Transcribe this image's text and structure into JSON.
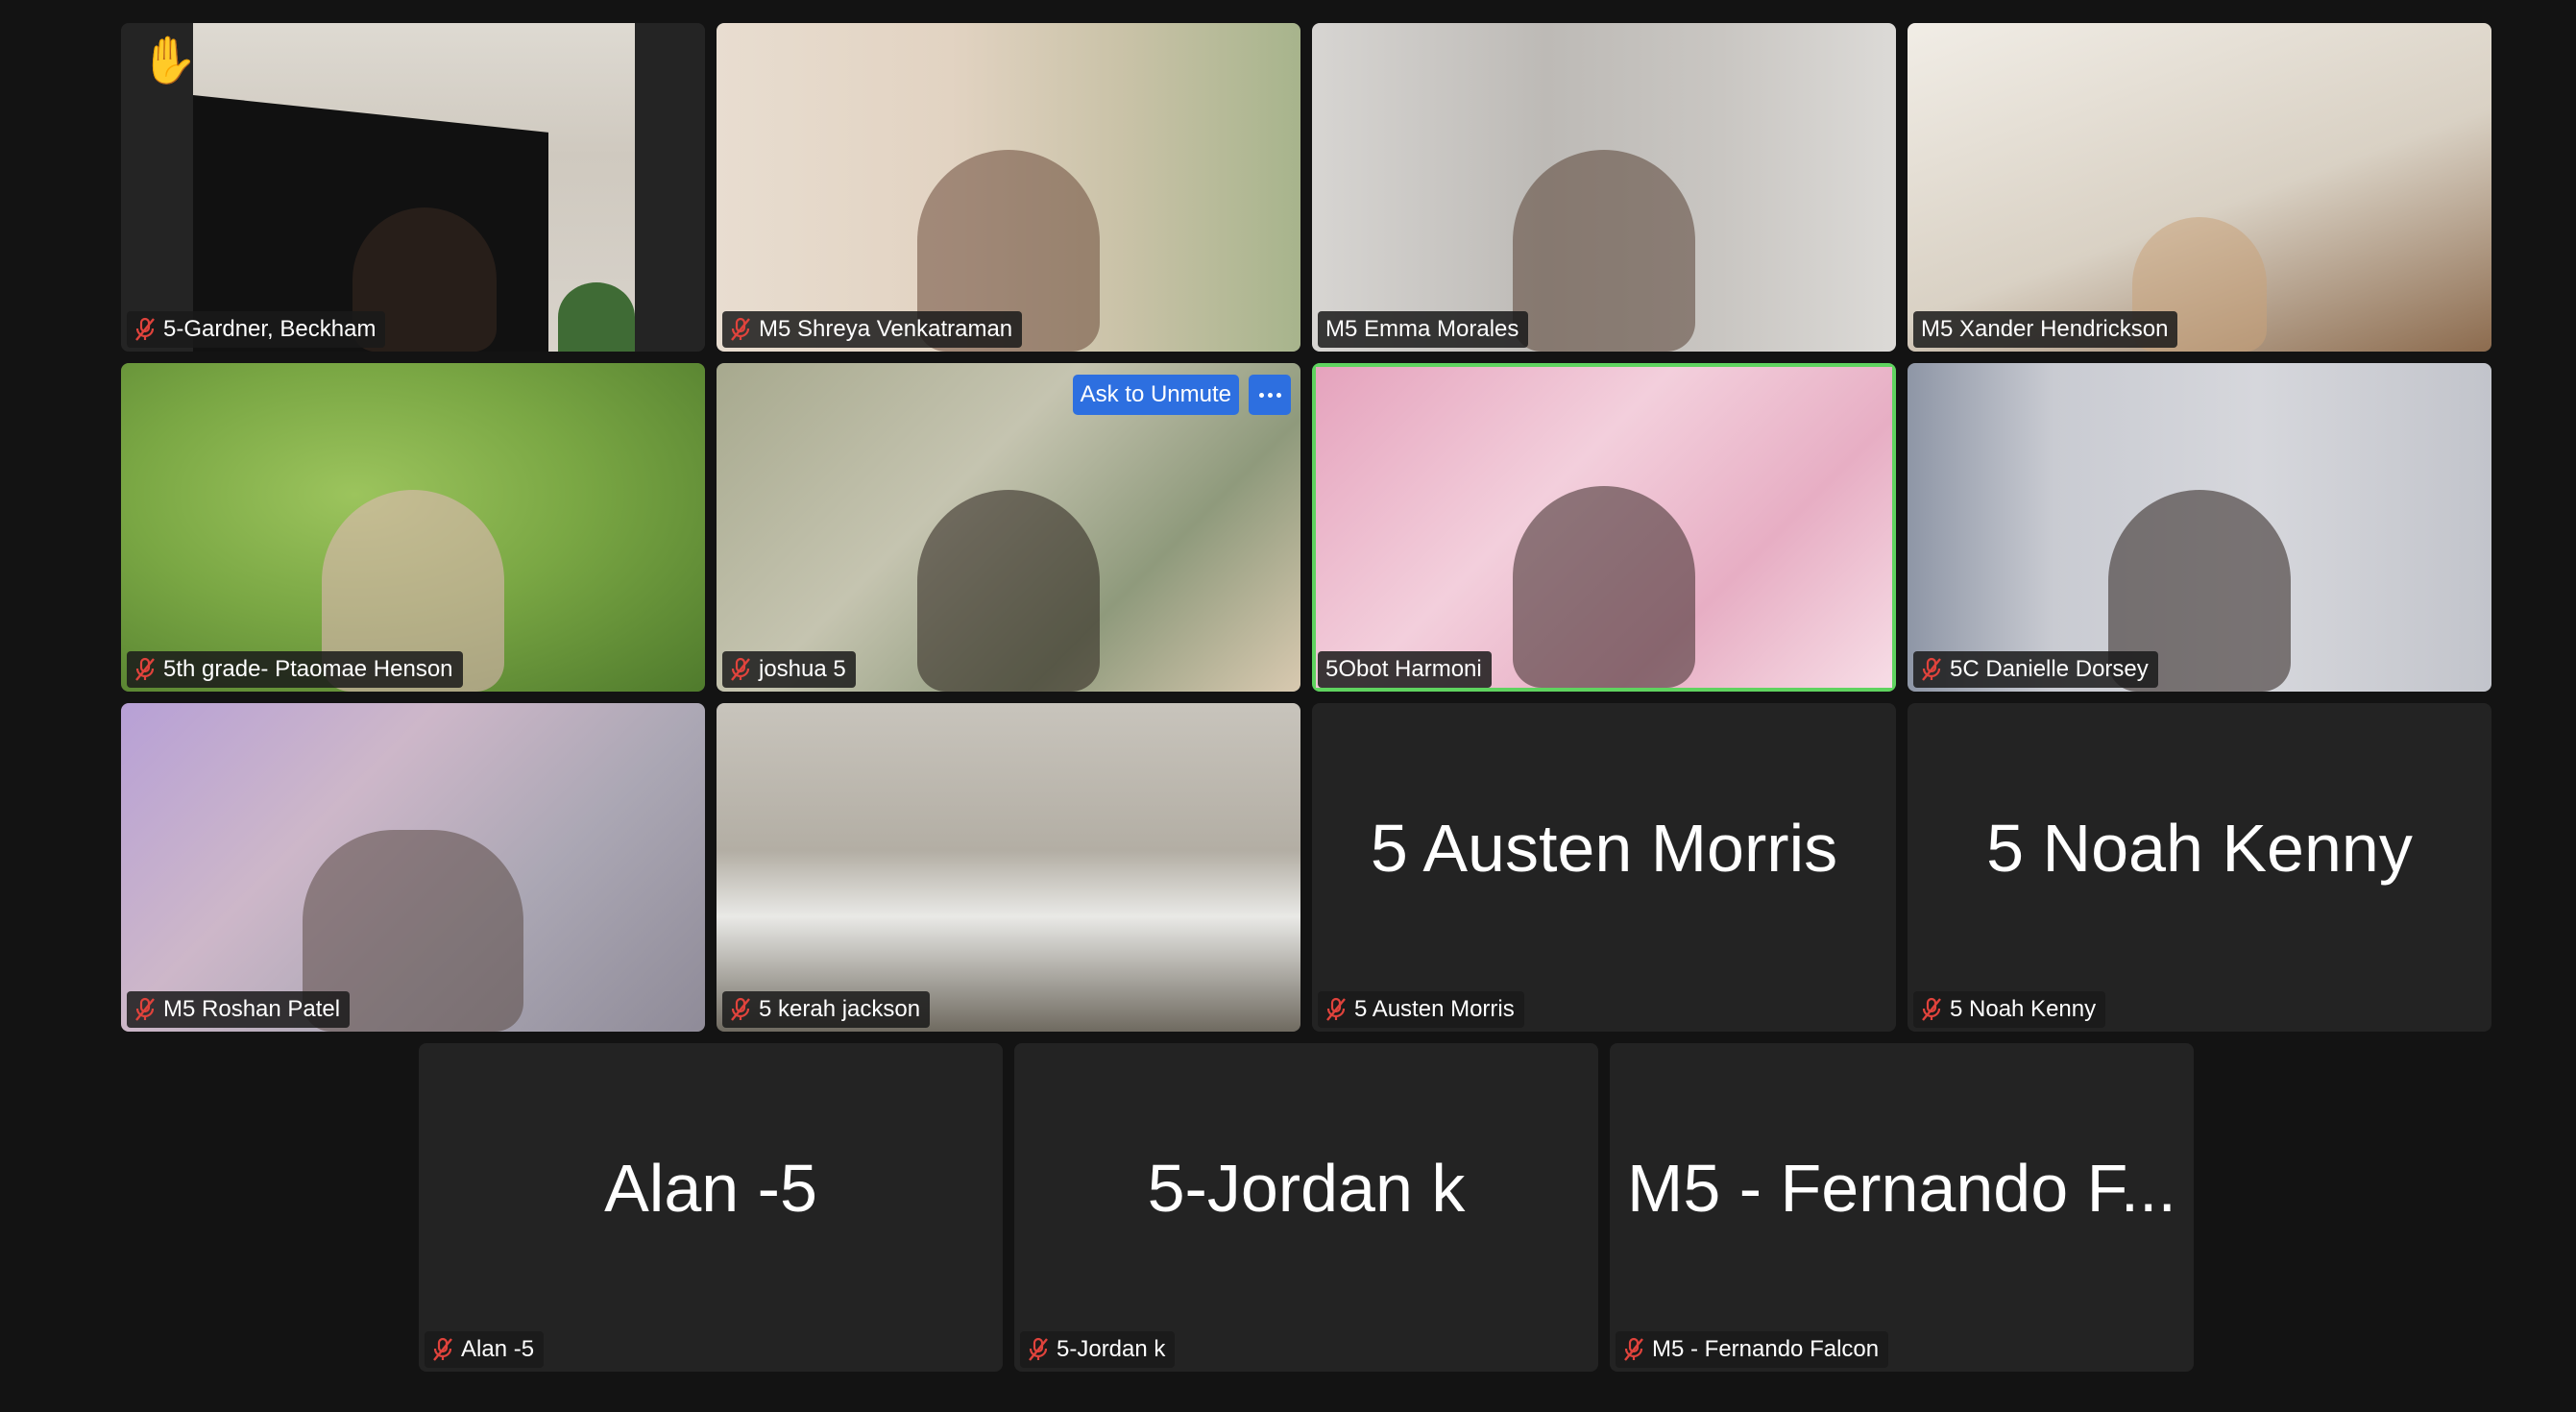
{
  "colors": {
    "background": "#131313",
    "tile": "#232323",
    "active_speaker_border": "#5fd35f",
    "mute_icon": "#e0433c",
    "button": "#2d6fe0"
  },
  "participants": [
    {
      "name": "5-Gardner, Beckham",
      "muted": true,
      "video": true,
      "raised_hand": true,
      "hand_icon": "✋"
    },
    {
      "name": "M5 Shreya Venkatraman",
      "muted": true,
      "video": true
    },
    {
      "name": "M5 Emma Morales",
      "muted": false,
      "video": true
    },
    {
      "name": "M5 Xander Hendrickson",
      "muted": false,
      "video": true
    },
    {
      "name": "5th grade- Ptaomae Henson",
      "muted": true,
      "video": true
    },
    {
      "name": "joshua 5",
      "muted": true,
      "video": true,
      "hovered": true
    },
    {
      "name": "5Obot Harmoni",
      "muted": false,
      "video": true,
      "active_speaker": true
    },
    {
      "name": "5C Danielle Dorsey",
      "muted": true,
      "video": true
    },
    {
      "name": "M5 Roshan Patel",
      "muted": true,
      "video": true
    },
    {
      "name": "5 kerah jackson",
      "muted": true,
      "video": true
    },
    {
      "name": "5 Austen Morris",
      "display_name": "5 Austen Morris",
      "muted": true,
      "video": false
    },
    {
      "name": "5 Noah Kenny",
      "display_name": "5 Noah Kenny",
      "muted": true,
      "video": false
    },
    {
      "name": "Alan -5",
      "display_name": "Alan -5",
      "muted": true,
      "video": false
    },
    {
      "name": "5-Jordan k",
      "display_name": "5-Jordan k",
      "muted": true,
      "video": false
    },
    {
      "name": "M5 - Fernando Falcon",
      "display_name": "M5 - Fernando F...",
      "muted": true,
      "video": false
    }
  ],
  "hover_controls": {
    "ask_to_unmute_label": "Ask to Unmute",
    "more_icon": "more-horizontal-icon"
  },
  "icons": {
    "muted": "microphone-muted-icon",
    "raised_hand": "raised-hand-icon"
  }
}
